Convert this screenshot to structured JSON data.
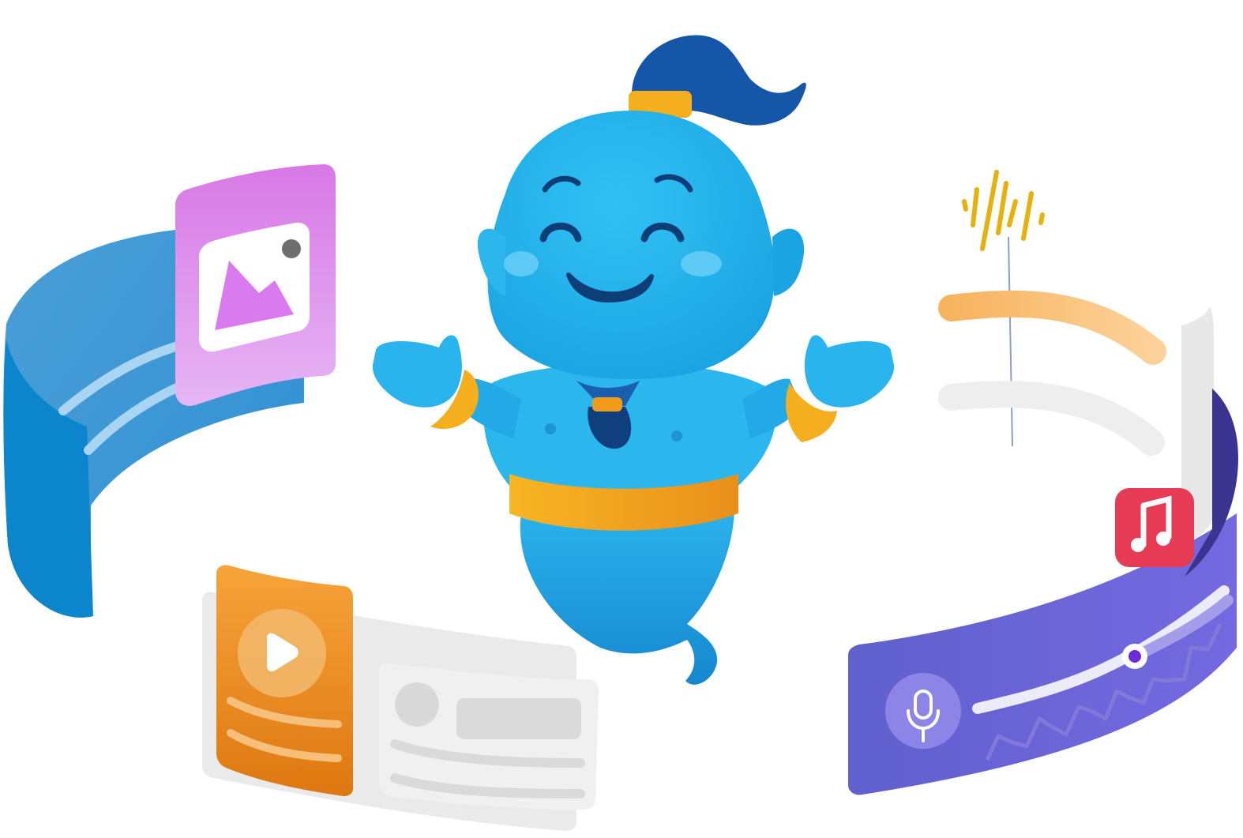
{
  "illustration": {
    "subject": "genie-mascot",
    "cards": [
      "image-card",
      "video-card",
      "audio-card",
      "voice-card"
    ]
  },
  "colors": {
    "genie_body": "#29B6EE",
    "genie_hair": "#1558A8",
    "gold": "#F7B21E",
    "gold_dark": "#E08A14",
    "eye_navy": "#0E3E78",
    "image_card": "#D98BEF",
    "image_band": "#1487CC",
    "video_card": "#F29B2C",
    "panel_gray": "#E9E9E9",
    "waveform_yellow": "#E8B40E",
    "audio_line_orange": "#F8B868",
    "voice_band": "#6A63D8",
    "music_icon_red": "#EC3E57"
  },
  "icons": [
    "image-icon",
    "play-icon",
    "music-note-icon",
    "microphone-icon",
    "waveform-icon"
  ]
}
